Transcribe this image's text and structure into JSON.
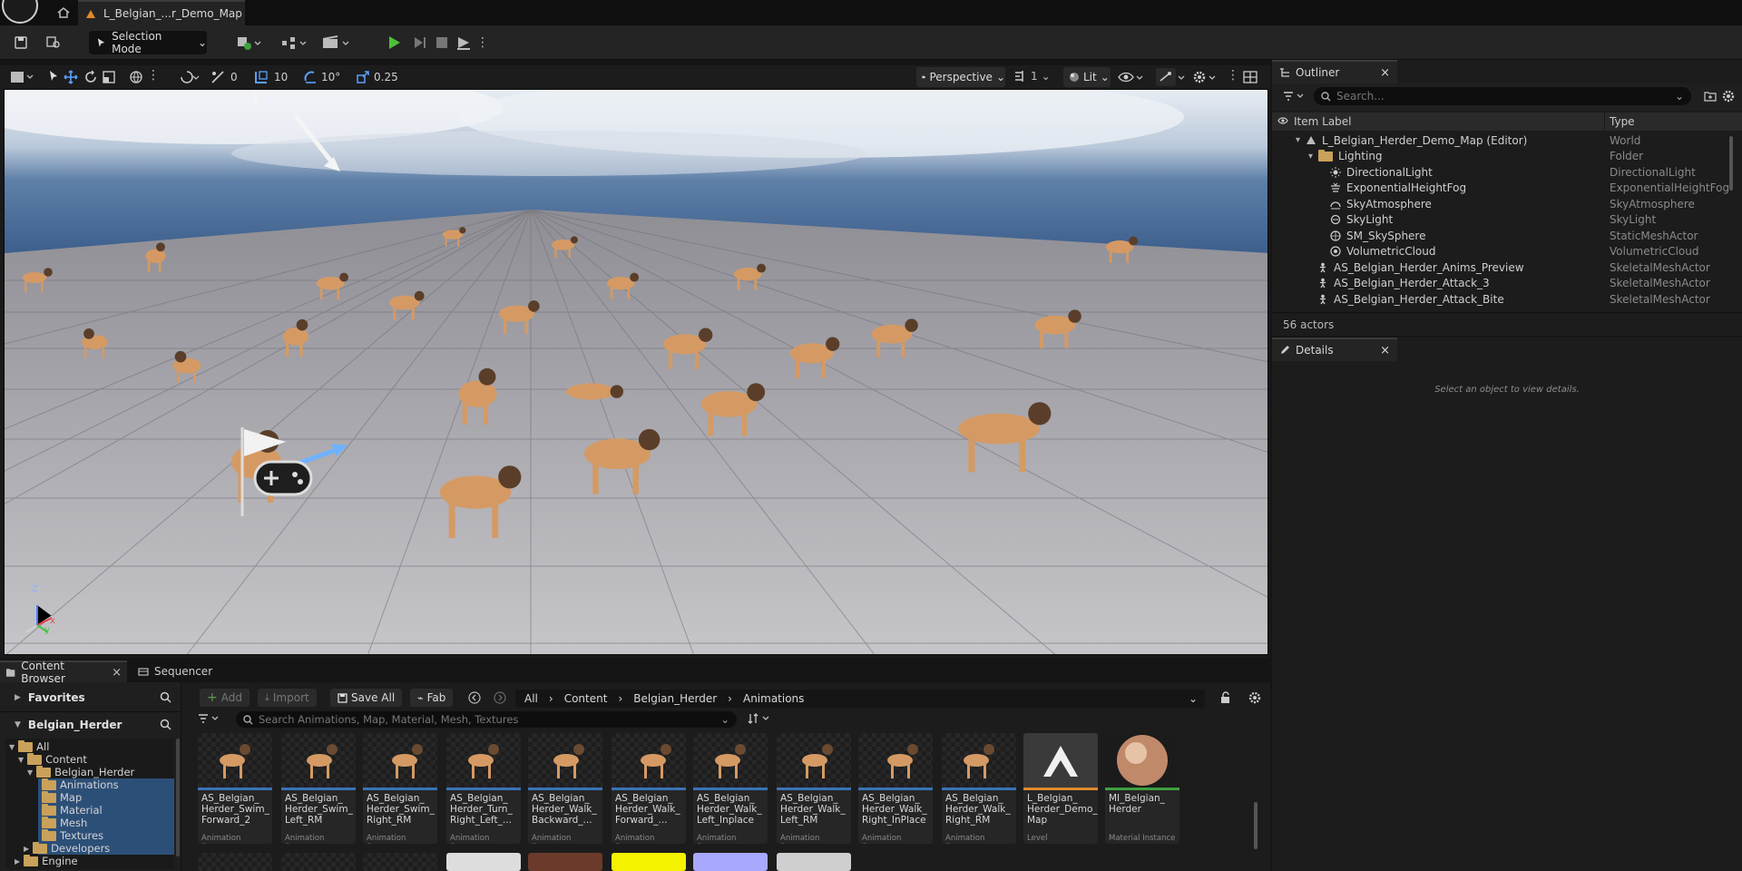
{
  "titlebar": {
    "level_tab": "L_Belgian_...r_Demo_Map"
  },
  "toolbar": {
    "selection_mode": "Selection Mode"
  },
  "viewport": {
    "select_snap": "0",
    "grid_snap": "10",
    "rotation_snap": "10°",
    "scale_snap": "0.25",
    "view_mode": "Perspective",
    "camera_count": "1",
    "lighting_mode": "Lit",
    "axis_z": "Z",
    "axis_x": "x",
    "axis_y": "y"
  },
  "outliner": {
    "tab": "Outliner",
    "search_placeholder": "Search...",
    "col_label": "Item Label",
    "col_type": "Type",
    "rows": [
      {
        "label": "L_Belgian_Herder_Demo_Map (Editor)",
        "type": "World",
        "icon": "level-icon"
      },
      {
        "label": "Lighting",
        "type": "Folder",
        "icon": "folder-icon"
      },
      {
        "label": "DirectionalLight",
        "type": "DirectionalLight",
        "icon": "sun-icon"
      },
      {
        "label": "ExponentialHeightFog",
        "type": "ExponentialHeightFog",
        "icon": "fog-icon"
      },
      {
        "label": "SkyAtmosphere",
        "type": "SkyAtmosphere",
        "icon": "atmosphere-icon"
      },
      {
        "label": "SkyLight",
        "type": "SkyLight",
        "icon": "skylight-icon"
      },
      {
        "label": "SM_SkySphere",
        "type": "StaticMeshActor",
        "icon": "mesh-icon"
      },
      {
        "label": "VolumetricCloud",
        "type": "VolumetricCloud",
        "icon": "cloud-icon"
      },
      {
        "label": "AS_Belgian_Herder_Anims_Preview",
        "type": "SkeletalMeshActor",
        "icon": "skeletal-icon"
      },
      {
        "label": "AS_Belgian_Herder_Attack_3",
        "type": "SkeletalMeshActor",
        "icon": "skeletal-icon"
      },
      {
        "label": "AS_Belgian_Herder_Attack_Bite",
        "type": "SkeletalMeshActor",
        "icon": "skeletal-icon"
      }
    ],
    "count": "56 actors"
  },
  "details": {
    "tab": "Details",
    "empty_message": "Select an object to view details."
  },
  "content_browser": {
    "tab": "Content Browser",
    "sequencer_tab": "Sequencer",
    "favorites": "Favorites",
    "collection": "Belgian_Herder",
    "tree": [
      "All",
      "Content",
      "Belgian_Herder",
      "Animations",
      "Map",
      "Material",
      "Mesh",
      "Textures",
      "Developers",
      "Engine"
    ],
    "add": "Add",
    "import": "Import",
    "save_all": "Save All",
    "fab": "Fab",
    "breadcrumb": [
      "All",
      "Content",
      "Belgian_Herder",
      "Animations"
    ],
    "search_placeholder": "Search Animations, Map, Material, Mesh, Textures",
    "assets": [
      {
        "name": "AS_Belgian_\nHerder_Swim_\nForward_2",
        "kind": "Animation Sequence"
      },
      {
        "name": "AS_Belgian_\nHerder_Swim_\nLeft_RM",
        "kind": "Animation Sequence"
      },
      {
        "name": "AS_Belgian_\nHerder_Swim_\nRight_RM",
        "kind": "Animation Sequence"
      },
      {
        "name": "AS_Belgian_\nHerder_Turn_\nRight_Left_...",
        "kind": "Animation Sequence"
      },
      {
        "name": "AS_Belgian_\nHerder_Walk_\nBackward_...",
        "kind": "Animation Sequence"
      },
      {
        "name": "AS_Belgian_\nHerder_Walk_\nForward_...",
        "kind": "Animation Sequence"
      },
      {
        "name": "AS_Belgian_\nHerder_Walk_\nLeft_Inplace",
        "kind": "Animation Sequence"
      },
      {
        "name": "AS_Belgian_\nHerder_Walk_\nLeft_RM",
        "kind": "Animation Sequence"
      },
      {
        "name": "AS_Belgian_\nHerder_Walk_\nRight_InPlace",
        "kind": "Animation Sequence"
      },
      {
        "name": "AS_Belgian_\nHerder_Walk_\nRight_RM",
        "kind": "Animation Sequence"
      },
      {
        "name": "L_Belgian_\nHerder_Demo_\nMap",
        "kind": "Level"
      },
      {
        "name": "MI_Belgian_\nHerder",
        "kind": "Material Instance"
      }
    ],
    "colors": {
      "anim_bar": "#3a73b8",
      "level_bar": "#e08a2b",
      "material_bar": "#3ea03e"
    }
  }
}
